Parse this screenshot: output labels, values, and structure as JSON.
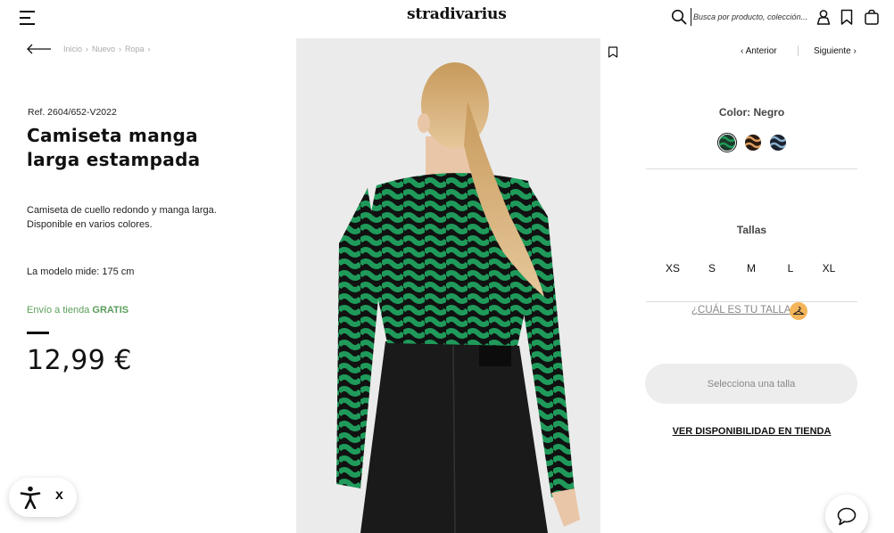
{
  "header": {
    "logo": "stradivarius",
    "search_placeholder": "Busca por producto, colección..."
  },
  "breadcrumb": [
    "Inicio",
    "Nuevo",
    "Ropa"
  ],
  "product": {
    "ref": "Ref. 2604/652-V2022",
    "title_line1": "Camiseta manga",
    "title_line2": "larga estampada",
    "description_line1": "Camiseta de cuello redondo y manga larga.",
    "description_line2": "Disponible en varios colores.",
    "model_info": "La modelo mide: 175 cm",
    "shipping_prefix": "Envío a tienda",
    "shipping_free": "GRATIS",
    "price": "12,99 €"
  },
  "nav": {
    "prev": "Anterior",
    "next": "Siguiente"
  },
  "colors": {
    "label": "Color: Negro",
    "swatches": [
      {
        "name": "green-black",
        "base": "#1c3a2a",
        "accent": "#1f9a5a",
        "selected": true
      },
      {
        "name": "orange-black",
        "base": "#2a1a10",
        "accent": "#e0a060",
        "selected": false
      },
      {
        "name": "blue-black",
        "base": "#1a2230",
        "accent": "#8ab0cc",
        "selected": false
      }
    ]
  },
  "sizes": {
    "label": "Tallas",
    "options": [
      "XS",
      "S",
      "M",
      "L",
      "XL"
    ]
  },
  "size_guide": "¿CUÁL ES TU TALLA?",
  "select_size_button": "Selecciona una talla",
  "store_availability": "VER DISPONIBILIDAD EN TIENDA",
  "accessibility": {
    "close": "x"
  },
  "theme": {
    "accent_green": "#5a9e5a",
    "hanger_orange": "#f5b55a"
  }
}
